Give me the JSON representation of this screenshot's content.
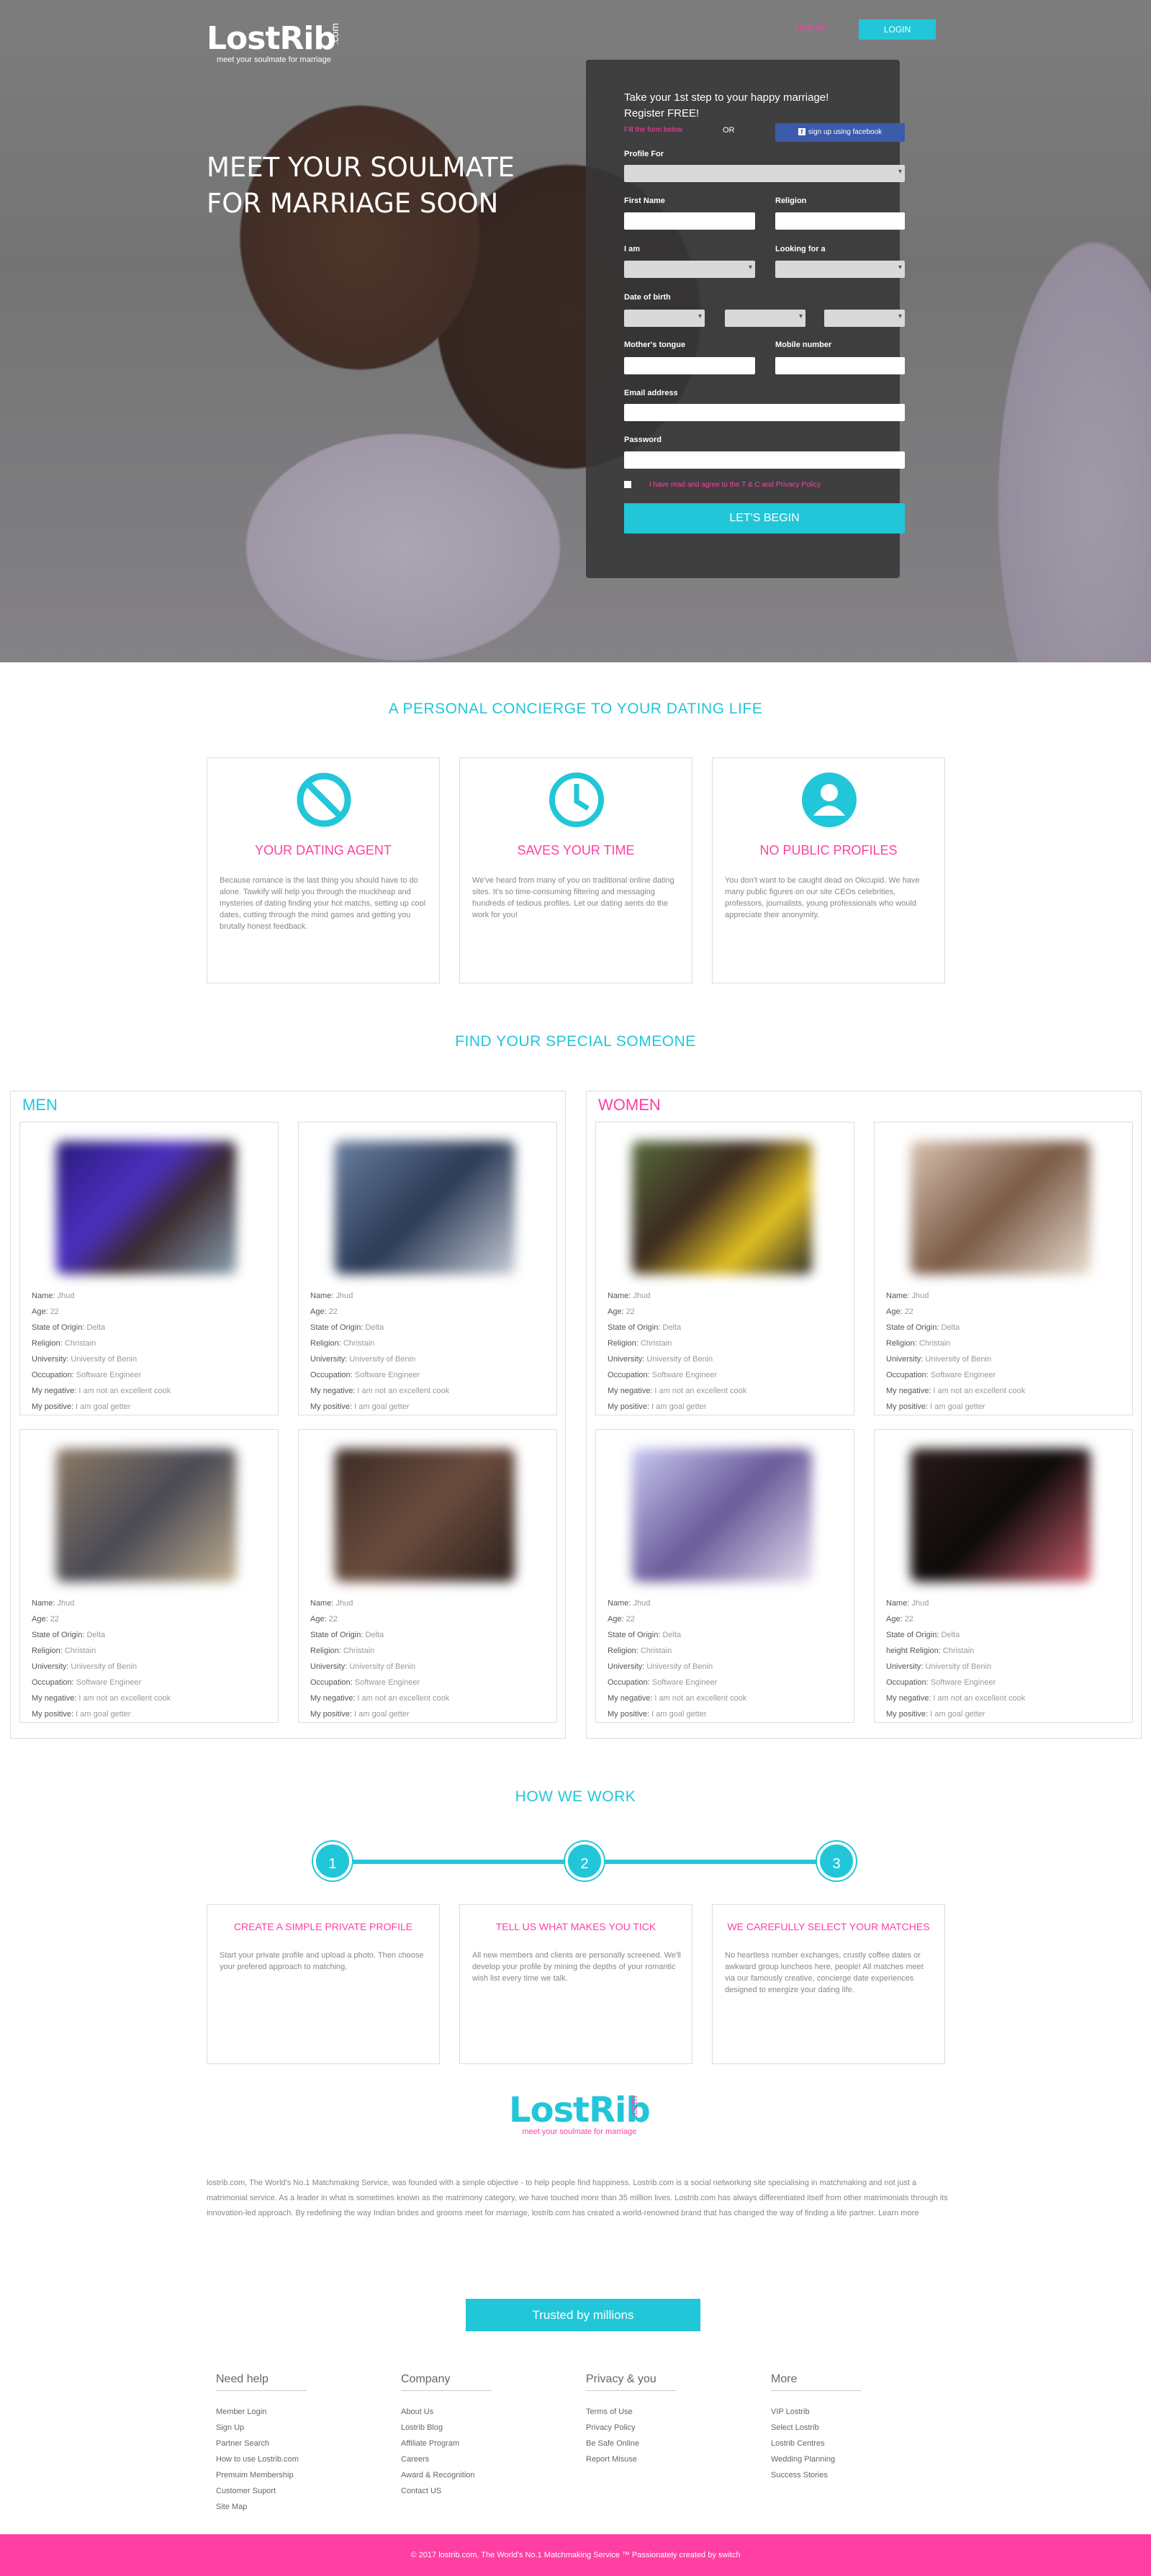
{
  "header": {
    "brand": "LostRib",
    "dotcom": ".com",
    "tagline": "meet your soulmate for marriage",
    "signup": "SIGN UP",
    "login": "LOGIN"
  },
  "hero": {
    "headline1": "MEET YOUR SOULMATE",
    "headline2": "FOR MARRIAGE SOON"
  },
  "form": {
    "title1": "Take your 1st step to your happy marriage!",
    "title2": "Register FREE!",
    "fill": "Fill the form below",
    "or": "OR",
    "facebook": "sign up using facebook",
    "profile_for": "Profile For",
    "first_name": "First Name",
    "religion": "Religion",
    "i_am": "I am",
    "looking_for": "Looking for a",
    "dob": "Date of birth",
    "mother_tongue": "Mother's tongue",
    "mobile": "Mobile number",
    "email": "Email address",
    "password": "Password",
    "agree": "I have read and agree to the T & C and Privacy Policy",
    "submit": "LET'S BEGIN"
  },
  "concierge": {
    "title": "A PERSONAL CONCIERGE TO YOUR DATING LIFE",
    "features": [
      {
        "title": "YOUR DATING AGENT",
        "icon": "no-entry-icon",
        "text": "Because romance is the last thing you should have to do alone. Tawkify will help you through the muckheap and mysteries of dating finding your hot matchs, setting up cool dates, cutting through the mind games and getting you brutally honest feedback."
      },
      {
        "title": "SAVES YOUR TIME",
        "icon": "clock-icon",
        "text": "We've heard from many of you on traditional online dating sites. It's so time-consuming filtering and messaging hundreds of tedious profiles. Let our dating aents do the work for you!"
      },
      {
        "title": "NO PUBLIC PROFILES",
        "icon": "user-icon",
        "text": "You don't want to be caught dead on Okcupid. We have many public figures on our site CEOs celebrities, professors, journalists, young professionals who would appreciate their anonymity."
      }
    ]
  },
  "find": {
    "title": "FIND YOUR SPECIAL SOMEONE",
    "men": "MEN",
    "women": "WOMEN",
    "labels": {
      "name": "Name:",
      "age": "Age:",
      "state": "State of Origin:",
      "religion": "Religion:",
      "university": "University:",
      "occupation": "Occupation:",
      "negative": "My negative:",
      "positive": "My positive:",
      "height": "height"
    },
    "profile": {
      "name": "Jhud",
      "age": "22",
      "state": "Delta",
      "religion": "Christain",
      "university": "University of Benin",
      "occupation": "Software Engineer",
      "negative": "I am not an excellent cook",
      "positive": "I am goal getter"
    }
  },
  "how": {
    "title": "HOW WE WORK",
    "steps": [
      "1",
      "2",
      "3"
    ],
    "items": [
      {
        "title": "CREATE A SIMPLE PRIVATE PROFILE",
        "text": "Start your private profile and upload a photo. Then choose your prefered approach to matching."
      },
      {
        "title": "TELL US WHAT MAKES YOU TICK",
        "text": "All new members and clients are personally screened. We'll develop your profile by mining the depths of your romantic wish list every time we talk."
      },
      {
        "title": "WE CAREFULLY SELECT YOUR MATCHES",
        "text": "No heartless number exchanges, crustly coffee dates or awkward group luncheos here, people! All matches meet via our famously creative, concierge date experiences designed to energize your dating life."
      }
    ]
  },
  "about": "lostrib.com, The World's No.1 Matchmaking Service, was founded with a simple objective - to help people find happiness. Lostrib.com is a social networking site specialising in matchmaking and not just a matrimonial service. As a leader in what is sometimes known as the matrimony category, we have touched more than 35 million lives. Lostrib.com has always differentiated itself from other matrimonials through its innovation-led approach. By redefining the way Indian brides and grooms meet for marriage, lostrib.com has created a world-renowned brand that has changed the way of finding a life partner. Learn more",
  "trusted": "Trusted by millions",
  "footer_cols": [
    {
      "title": "Need help",
      "links": [
        "Member Login",
        "Sign Up",
        "Partner Search",
        "How to use Lostrib.com",
        "Premuim Membership",
        "Customer Suport",
        "Site Map"
      ]
    },
    {
      "title": "Company",
      "links": [
        "About Us",
        "Lostrib Blog",
        "Affiliate Program",
        "Careers",
        "Award & Recognition",
        "Contact US"
      ]
    },
    {
      "title": "Privacy & you",
      "links": [
        "Terms of Use",
        "Privacy Policy",
        "Be Safe Online",
        "Report Misuse"
      ]
    },
    {
      "title": "More",
      "links": [
        "VIP Lostrib",
        "Select Lostrib",
        "Lostrib Centres",
        "Wedding Planning",
        "Success Stories"
      ]
    }
  ],
  "copyright": "© 2017 lostrib.com, The World's No.1 Matchmaking Service ™ Passionately created by switch",
  "colors": {
    "accent": "#22c6d9",
    "pink": "#ff3fa4"
  }
}
